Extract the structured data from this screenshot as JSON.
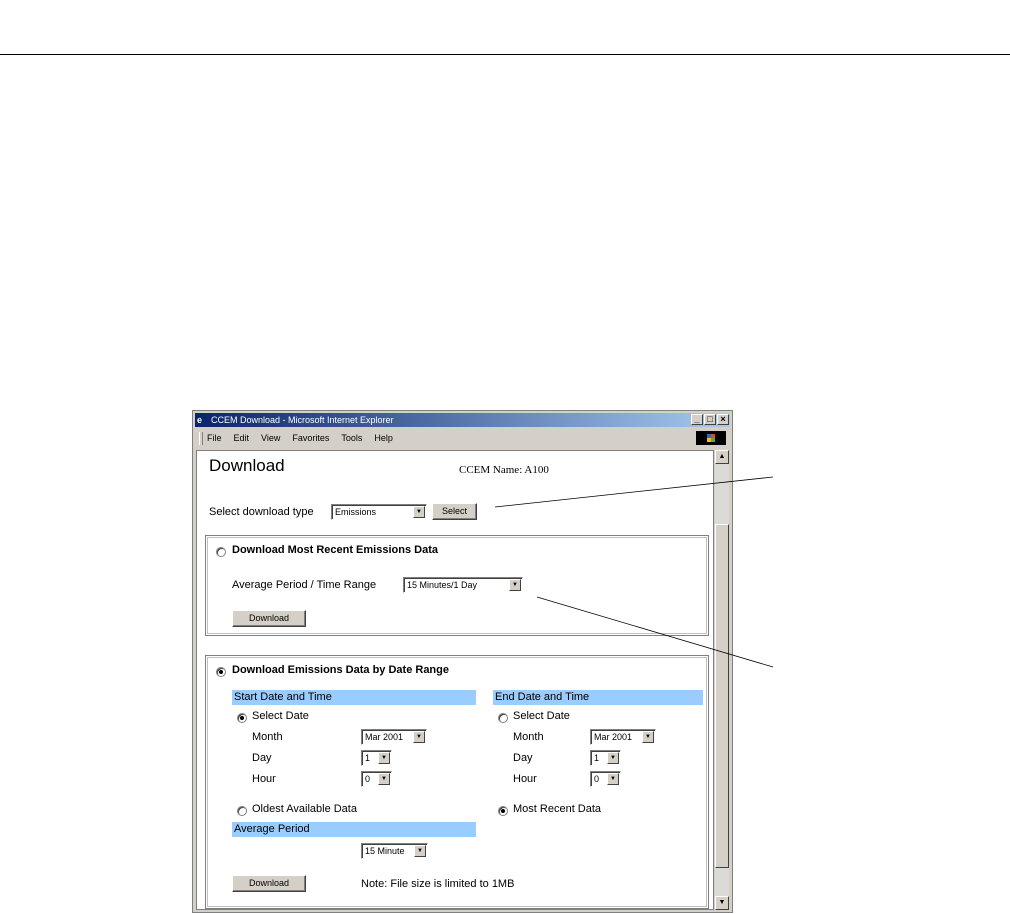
{
  "window": {
    "title": "CCEM Download - Microsoft Internet Explorer",
    "controls": [
      "_",
      "□",
      "×"
    ]
  },
  "menu": [
    "File",
    "Edit",
    "View",
    "Favorites",
    "Tools",
    "Help"
  ],
  "page": {
    "title": "Download",
    "ccem_name": "CCEM Name: A100",
    "select_type_label": "Select download type",
    "select_type_value": "Emissions",
    "select_button": "Select"
  },
  "recent": {
    "heading": "Download Most Recent Emissions Data",
    "avg_label": "Average Period / Time Range",
    "avg_value": "15 Minutes/1 Day",
    "download_button": "Download"
  },
  "range": {
    "heading": "Download Emissions Data by Date Range",
    "start": {
      "band": "Start Date and Time",
      "select_date": "Select Date",
      "month_label": "Month",
      "month_value": "Mar 2001",
      "day_label": "Day",
      "day_value": "1",
      "hour_label": "Hour",
      "hour_value": "0",
      "oldest": "Oldest Available Data"
    },
    "end": {
      "band": "End Date and Time",
      "select_date": "Select Date",
      "month_label": "Month",
      "month_value": "Mar 2001",
      "day_label": "Day",
      "day_value": "1",
      "hour_label": "Hour",
      "hour_value": "0",
      "most_recent": "Most Recent Data"
    },
    "avg_band": "Average Period",
    "avg_value": "15 Minute",
    "download_button": "Download",
    "note": "Note: File size is limited to 1MB"
  }
}
